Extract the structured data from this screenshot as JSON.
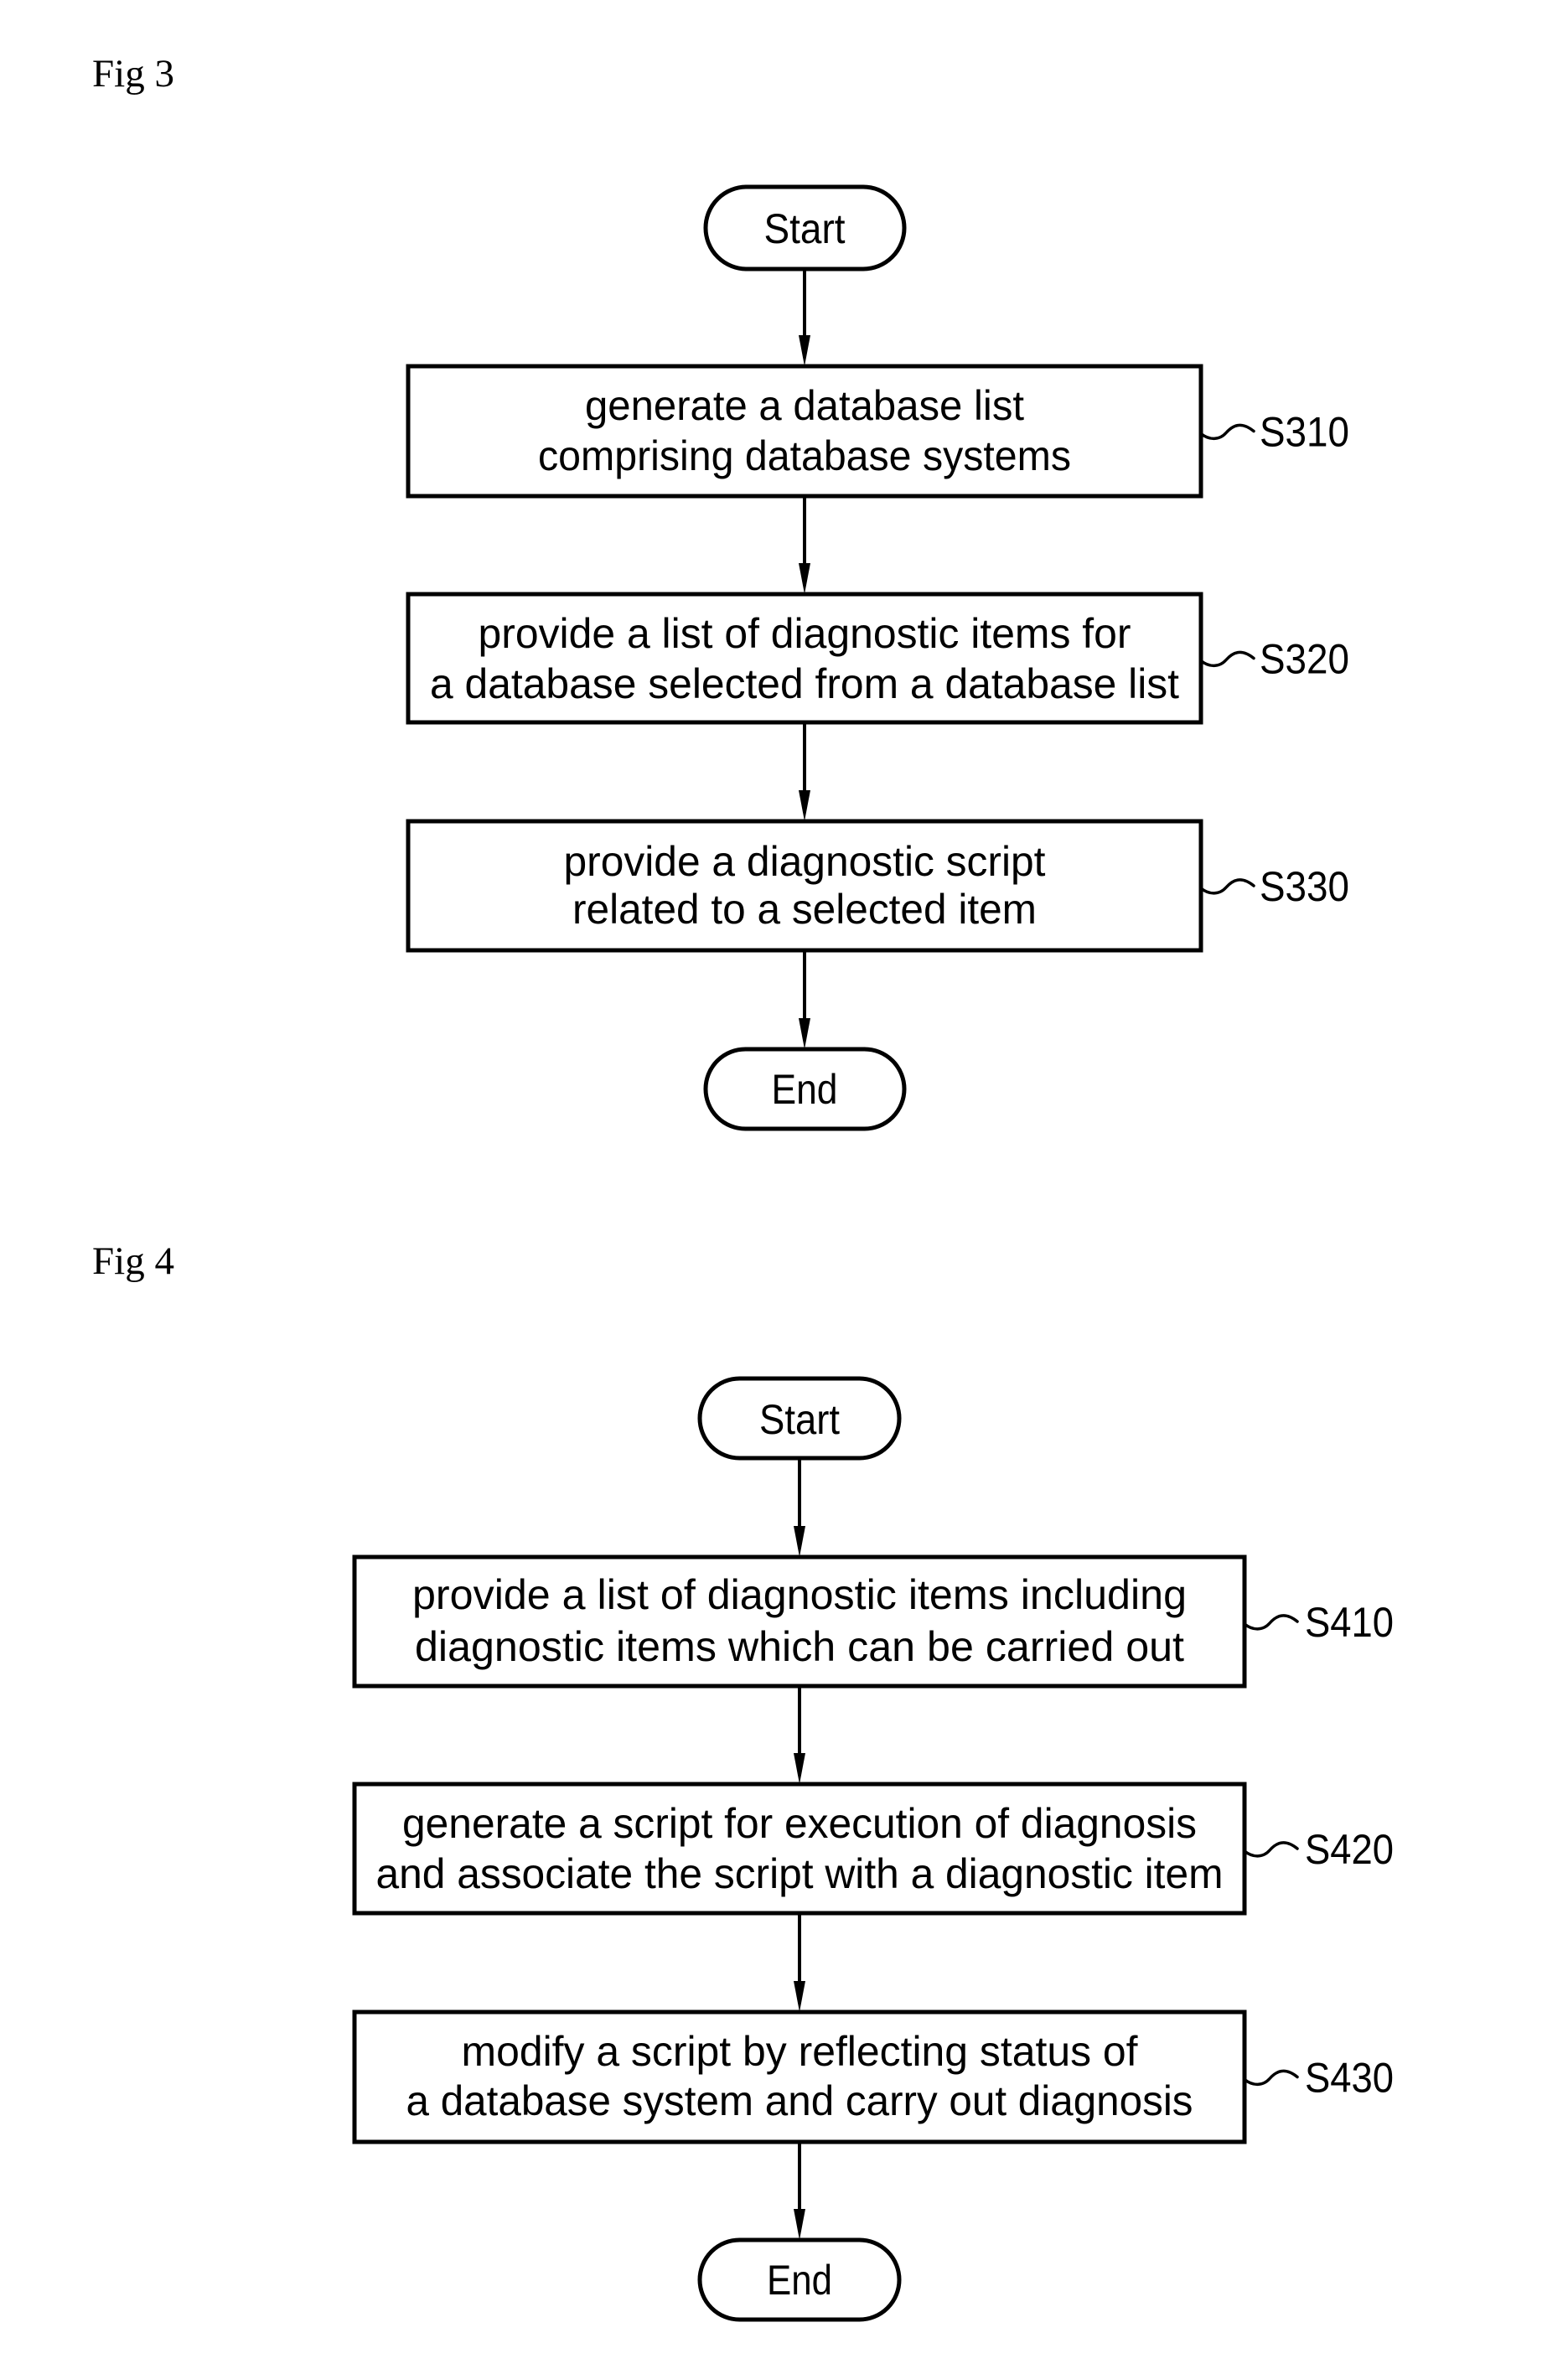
{
  "colors": {
    "ink": "#000000",
    "background": "#ffffff"
  },
  "figures": [
    {
      "label": "Fig 3",
      "start": "Start",
      "end": "End",
      "steps": [
        {
          "ref": "S310",
          "lines": [
            "generate a database list",
            "comprising database systems"
          ]
        },
        {
          "ref": "S320",
          "lines": [
            "provide a list of diagnostic items for",
            "a database selected from a database list"
          ]
        },
        {
          "ref": "S330",
          "lines": [
            "provide a diagnostic script",
            "related to a selected item"
          ]
        }
      ]
    },
    {
      "label": "Fig 4",
      "start": "Start",
      "end": "End",
      "steps": [
        {
          "ref": "S410",
          "lines": [
            "provide a list of diagnostic items including",
            "diagnostic items which can be carried out"
          ]
        },
        {
          "ref": "S420",
          "lines": [
            "generate a script for execution of diagnosis",
            "and associate the script with a diagnostic item"
          ]
        },
        {
          "ref": "S430",
          "lines": [
            "modify a script by reflecting status of",
            "a database system and carry out diagnosis"
          ]
        }
      ]
    }
  ]
}
